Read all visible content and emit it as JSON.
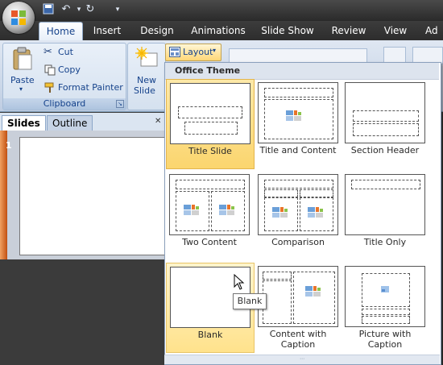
{
  "quick_access": {
    "icons": [
      "save-icon",
      "undo-icon",
      "redo-icon",
      "customize-icon"
    ]
  },
  "tabs": [
    {
      "label": "Home",
      "active": true
    },
    {
      "label": "Insert"
    },
    {
      "label": "Design"
    },
    {
      "label": "Animations"
    },
    {
      "label": "Slide Show"
    },
    {
      "label": "Review"
    },
    {
      "label": "View"
    },
    {
      "label": "Ad"
    }
  ],
  "clipboard": {
    "paste": "Paste",
    "cut": "Cut",
    "copy": "Copy",
    "format_painter": "Format Painter",
    "group_label": "Clipboard"
  },
  "slides": {
    "new_slide_line1": "New",
    "new_slide_line2": "Slide",
    "layout": "Layout"
  },
  "pane": {
    "tab_slides": "Slides",
    "tab_outline": "Outline",
    "slide_number": "1"
  },
  "gallery": {
    "header": "Office Theme",
    "layouts": [
      {
        "name": "Title Slide",
        "selected": true
      },
      {
        "name": "Title and Content"
      },
      {
        "name": "Section Header"
      },
      {
        "name": "Two Content"
      },
      {
        "name": "Comparison"
      },
      {
        "name": "Title Only"
      },
      {
        "name": "Blank",
        "hovered": true
      },
      {
        "name": "Content with Caption"
      },
      {
        "name": "Picture with Caption"
      }
    ]
  },
  "tooltip": "Blank",
  "colors": {
    "ribbon_blue": "#15428b",
    "selection": "#fbd56e",
    "slide_pane_accent": "#c85a1a"
  }
}
